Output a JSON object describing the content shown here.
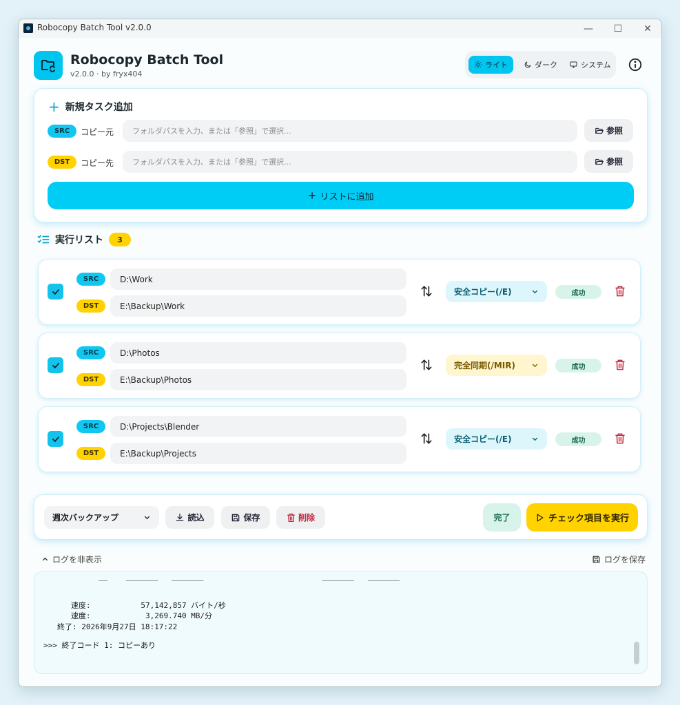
{
  "window": {
    "title": "Robocopy Batch Tool  v2.0.0",
    "minimize": "—",
    "maximize": "☐",
    "close": "✕"
  },
  "header": {
    "title": "Robocopy Batch Tool",
    "subtitle": "v2.0.0 · by fryx404",
    "theme": {
      "light": "ライト",
      "dark": "ダーク",
      "system": "システム",
      "selected": "ライト"
    }
  },
  "add_task": {
    "title": "新規タスク追加",
    "src_badge": "SRC",
    "src_label": "コピー元",
    "src_placeholder": "フォルダパスを入力、または「参照」で選択...",
    "dst_badge": "DST",
    "dst_label": "コピー先",
    "dst_placeholder": "フォルダパスを入力、または「参照」で選択...",
    "browse_label": "参照",
    "add_button": "リストに追加"
  },
  "task_list": {
    "title": "実行リスト",
    "count": "3",
    "tasks": [
      {
        "checked": true,
        "src_badge": "SRC",
        "src": "D:\\Work",
        "dst_badge": "DST",
        "dst": "E:\\Backup\\Work",
        "mode": "安全コピー(/E)",
        "mode_kind": "safe",
        "status": "成功"
      },
      {
        "checked": true,
        "src_badge": "SRC",
        "src": "D:\\Photos",
        "dst_badge": "DST",
        "dst": "E:\\Backup\\Photos",
        "mode": "完全同期(/MIR)",
        "mode_kind": "mir",
        "status": "成功"
      },
      {
        "checked": true,
        "src_badge": "SRC",
        "src": "D:\\Projects\\Blender",
        "dst_badge": "DST",
        "dst": "E:\\Backup\\Projects",
        "mode": "安全コピー(/E)",
        "mode_kind": "safe",
        "status": "成功"
      }
    ]
  },
  "actions": {
    "preset": "週次バックアップ",
    "load": "読込",
    "save": "保存",
    "delete": "削除",
    "done": "完了",
    "run": "チェック項目を実行"
  },
  "log": {
    "toggle": "ログを非表示",
    "save": "ログを保存",
    "lines": [
      "   速度:           57,142,857 バイト/秒",
      "   速度:            3,269.740 MB/分",
      "終了: 2026年9月27日 18:17:22",
      ">>> 終了コード 1: コピーあり"
    ]
  },
  "colors": {
    "accent": "#00c6ef",
    "src": "#0fc7f0",
    "dst": "#ffd200",
    "danger": "#c0283c",
    "success_bg": "#d8f4ea"
  }
}
